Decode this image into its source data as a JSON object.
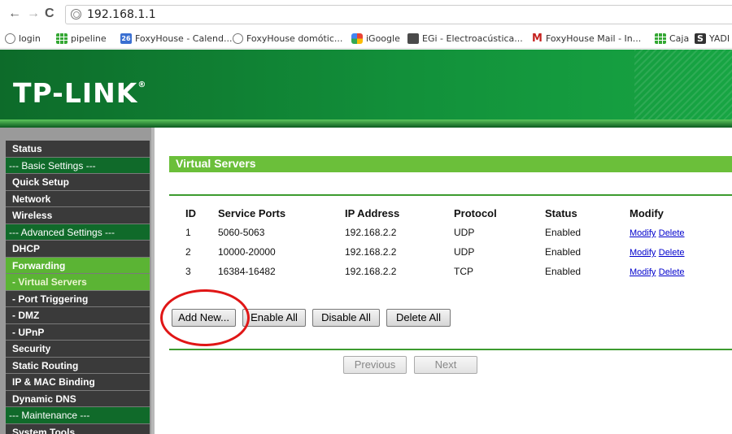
{
  "browser": {
    "url": "192.168.1.1",
    "bookmarks": [
      {
        "label": "login",
        "icon": "globe-icon"
      },
      {
        "label": "pipeline",
        "icon": "spreadsheet-icon"
      },
      {
        "label": "FoxyHouse - Calend...",
        "icon": "calendar-icon",
        "icon_text": "26"
      },
      {
        "label": "FoxyHouse domótic...",
        "icon": "globe-icon"
      },
      {
        "label": "iGoogle",
        "icon": "igoogle-icon"
      },
      {
        "label": "EGi - Electroacústica...",
        "icon": "egi-icon"
      },
      {
        "label": "FoxyHouse Mail - In...",
        "icon": "gmail-icon",
        "icon_text": "M"
      },
      {
        "label": "Caja",
        "icon": "spreadsheet-icon"
      },
      {
        "label": "YADI",
        "icon": "s-icon",
        "icon_text": "S"
      }
    ]
  },
  "brand": {
    "logo": "TP-LINK",
    "mark": "®"
  },
  "menu": [
    {
      "label": "Status",
      "kind": "item"
    },
    {
      "label": "--- Basic Settings ---",
      "kind": "section"
    },
    {
      "label": "Quick Setup",
      "kind": "item"
    },
    {
      "label": "Network",
      "kind": "item"
    },
    {
      "label": "Wireless",
      "kind": "item"
    },
    {
      "label": "--- Advanced Settings ---",
      "kind": "section"
    },
    {
      "label": "DHCP",
      "kind": "item"
    },
    {
      "label": "Forwarding",
      "kind": "active"
    },
    {
      "label": "- Virtual Servers",
      "kind": "sub-active"
    },
    {
      "label": "- Port Triggering",
      "kind": "sub"
    },
    {
      "label": "- DMZ",
      "kind": "sub"
    },
    {
      "label": "- UPnP",
      "kind": "sub"
    },
    {
      "label": "Security",
      "kind": "item"
    },
    {
      "label": "Static Routing",
      "kind": "item"
    },
    {
      "label": "IP & MAC Binding",
      "kind": "item"
    },
    {
      "label": "Dynamic DNS",
      "kind": "item"
    },
    {
      "label": "--- Maintenance ---",
      "kind": "section"
    },
    {
      "label": "System Tools",
      "kind": "item"
    }
  ],
  "page": {
    "title": "Virtual Servers",
    "columns": [
      "ID",
      "Service Ports",
      "IP Address",
      "Protocol",
      "Status",
      "Modify"
    ],
    "rows": [
      {
        "id": "1",
        "ports": "5060-5063",
        "ip": "192.168.2.2",
        "protocol": "UDP",
        "status": "Enabled",
        "modify": "Modify",
        "delete": "Delete"
      },
      {
        "id": "2",
        "ports": "10000-20000",
        "ip": "192.168.2.2",
        "protocol": "UDP",
        "status": "Enabled",
        "modify": "Modify",
        "delete": "Delete"
      },
      {
        "id": "3",
        "ports": "16384-16482",
        "ip": "192.168.2.2",
        "protocol": "TCP",
        "status": "Enabled",
        "modify": "Modify",
        "delete": "Delete"
      }
    ],
    "buttons": {
      "add_new": "Add New...",
      "enable_all": "Enable All",
      "disable_all": "Disable All",
      "delete_all": "Delete All",
      "previous": "Previous",
      "next": "Next"
    }
  },
  "colors": {
    "brand_green": "#12903a",
    "title_green": "#6bbf3a",
    "menu_dark": "#3a3a3a",
    "annotation_red": "#e01616"
  }
}
